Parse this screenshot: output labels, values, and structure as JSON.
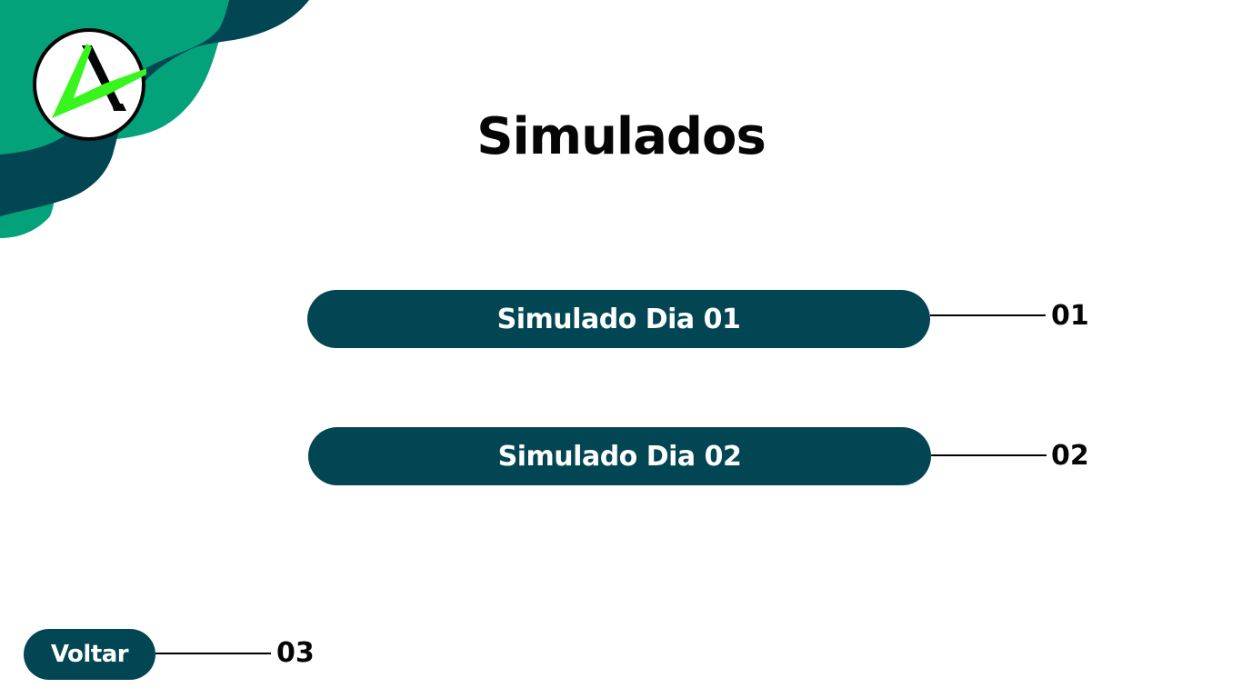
{
  "page": {
    "title": "Simulados"
  },
  "menu": {
    "items": [
      {
        "label": "Simulado Dia 01",
        "number": "01"
      },
      {
        "label": "Simulado Dia 02",
        "number": "02"
      }
    ],
    "back": {
      "label": "Voltar",
      "number": "03"
    }
  },
  "logo": {
    "icon": "logo-icon",
    "letter": "A"
  },
  "colors": {
    "button_bg": "#024653",
    "wave_light": "#03A27A",
    "wave_dark": "#024653",
    "logo_accent": "#38F51E",
    "text": "#050505"
  }
}
